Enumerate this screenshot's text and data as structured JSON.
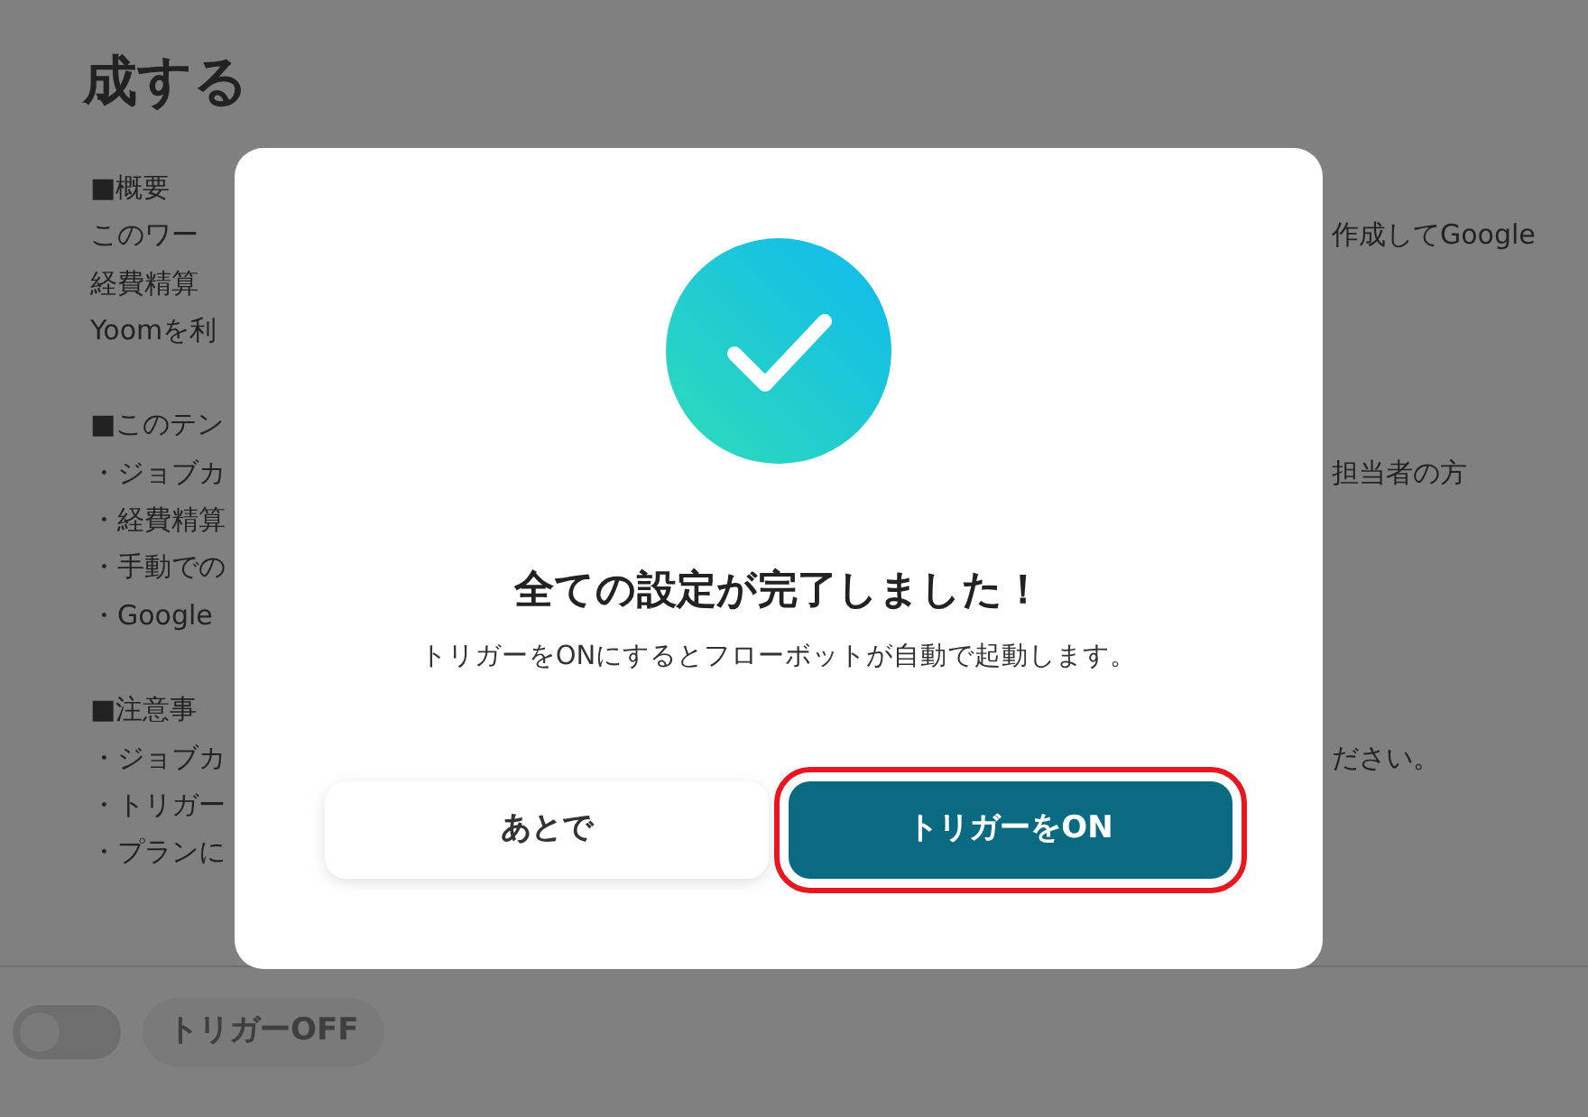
{
  "page": {
    "title": "成する",
    "sections": [
      {
        "lines": [
          {
            "left": "■概要"
          },
          {
            "left": "このワー",
            "right": "作成してGoogle"
          },
          {
            "left": "経費精算"
          },
          {
            "left": "Yoomを利"
          }
        ]
      },
      {
        "lines": [
          {
            "left": "■このテン"
          },
          {
            "left": "・ジョブカ",
            "right": "担当者の方"
          },
          {
            "left": "・経費精算"
          },
          {
            "left": "・手動での"
          },
          {
            "left": "・Google"
          }
        ]
      },
      {
        "lines": [
          {
            "left": "■注意事"
          },
          {
            "left": "・ジョブカ",
            "right": "ださい。"
          },
          {
            "left": "・トリガー"
          },
          {
            "left": "・プランに"
          }
        ]
      }
    ]
  },
  "dialog": {
    "title": "全ての設定が完了しました！",
    "message": "トリガーをONにするとフローボットが自動で起動します。",
    "buttons": [
      {
        "label": "あとで",
        "kind": "secondary",
        "highlighted": false
      },
      {
        "label": "トリガーをON",
        "kind": "primary",
        "highlighted": true
      }
    ]
  },
  "footer": {
    "trigger": {
      "on": false,
      "label": "トリガーOFF"
    }
  }
}
